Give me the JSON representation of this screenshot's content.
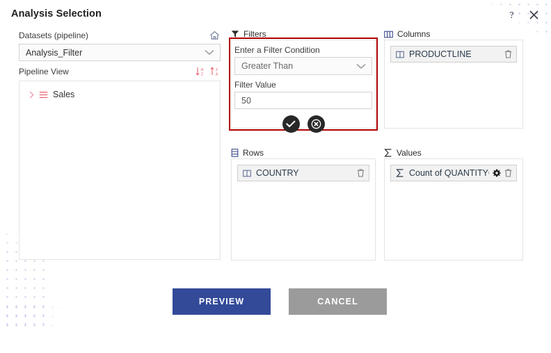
{
  "window": {
    "title": "Analysis Selection",
    "help_icon": "question-mark-icon",
    "close_icon": "close-icon"
  },
  "left": {
    "datasets_label": "Datasets (pipeline)",
    "home_icon": "home-icon",
    "dataset_selected": "Analysis_Filter",
    "dataset_chevron": "chevron-down-icon",
    "pipeline_label": "Pipeline View",
    "sort_desc_icon": "sort-descending-az-icon",
    "sort_asc_icon": "sort-ascending-az-icon",
    "tree": [
      {
        "label": "Sales",
        "expander": "chevron-right-icon",
        "icon": "table-rows-icon"
      }
    ]
  },
  "filters": {
    "header": "Filters",
    "header_icon": "funnel-icon",
    "condition_label": "Enter a Filter Condition",
    "condition_value": "Greater Than",
    "condition_chevron": "chevron-down-icon",
    "value_label": "Filter Value",
    "value": "50",
    "confirm_icon": "check-icon",
    "cancel_icon": "x-circle-icon",
    "highlight_color": "#b00000"
  },
  "columns": {
    "header": "Columns",
    "header_icon": "columns-icon",
    "chips": [
      {
        "label": "PRODUCTLINE",
        "icon": "column-icon",
        "delete_icon": "trash-icon"
      }
    ]
  },
  "rows": {
    "header": "Rows",
    "header_icon": "rows-icon",
    "chips": [
      {
        "label": "COUNTRY",
        "icon": "column-icon",
        "delete_icon": "trash-icon"
      }
    ]
  },
  "values": {
    "header": "Values",
    "header_icon": "sigma-icon",
    "chips": [
      {
        "label": "Count of QUANTITYOR...",
        "icon": "sigma-icon",
        "settings_icon": "gear-icon",
        "delete_icon": "trash-icon"
      }
    ]
  },
  "footer": {
    "preview_label": "PREVIEW",
    "cancel_label": "CANCEL",
    "preview_color": "#334a99",
    "cancel_color": "#9b9b9b"
  }
}
